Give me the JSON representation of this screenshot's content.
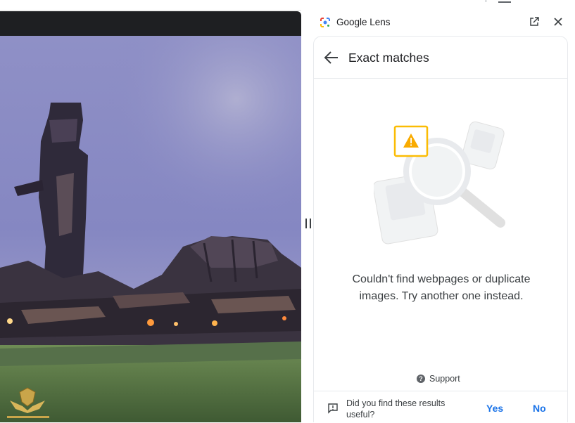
{
  "lens": {
    "title": "Google Lens",
    "open_in_tab_icon": "open-in-new-icon",
    "close_icon": "close-icon"
  },
  "panel": {
    "back_icon": "arrow-back-icon",
    "title": "Exact matches",
    "empty_message": "Couldn't find webpages or duplicate images. Try another one instead.",
    "support_label": "Support",
    "feedback": {
      "question": "Did you find these results useful?",
      "yes": "Yes",
      "no": "No"
    }
  },
  "viewer": {
    "watermark_icon": "emblem-watermark-icon"
  },
  "colors": {
    "accent": "#1a73e8",
    "warning": "#fbbc04",
    "text": "#202124"
  }
}
